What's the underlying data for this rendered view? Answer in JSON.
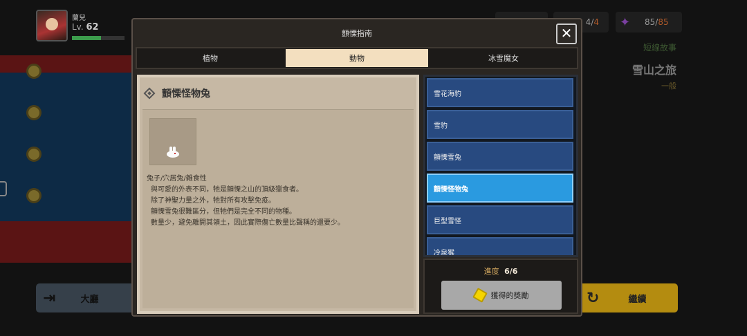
{
  "player": {
    "name": "蘭兒",
    "level_prefix": "Lv.",
    "level": "62",
    "xp_fraction": 0.55
  },
  "resources": {
    "energy_current": "4",
    "energy_max": "4",
    "gem_current": "85",
    "gem_max": "85"
  },
  "story": {
    "type": "短線故事",
    "title": "雪山之旅",
    "difficulty": "一般"
  },
  "buttons": {
    "lobby_label": "大廳",
    "continue_label": "繼續"
  },
  "modal": {
    "title": "顫慄指南",
    "close_symbol": "✕",
    "tabs": [
      {
        "label": "植物",
        "active": false
      },
      {
        "label": "動物",
        "active": true
      },
      {
        "label": "冰雪魔女",
        "active": false
      }
    ],
    "detail": {
      "name": "顫慄怪物兔",
      "description": [
        "兔子/穴居兔/雜食性",
        "與可愛的外表不同，牠是顫慄之山的頂級獵食者。",
        "除了神聖力量之外，牠對所有攻擊免疫。",
        "顫慄雪兔很難區分，但牠們是完全不同的物種。",
        "數量少，避免離開其領土，因此實際傷亡數量比聲稱的還要少。"
      ]
    },
    "list": [
      {
        "label": "雪花海豹",
        "active": false
      },
      {
        "label": "雪豹",
        "active": false
      },
      {
        "label": "顫慄雪兔",
        "active": false
      },
      {
        "label": "顫慄怪物兔",
        "active": true
      },
      {
        "label": "巨型雪怪",
        "active": false
      },
      {
        "label": "冷泉猴",
        "active": false
      }
    ],
    "progress_label": "進度",
    "progress_value": "6/6",
    "reward_label": "獲得的獎勵"
  },
  "colors": {
    "active_tab": "#f3dfbf",
    "list_item": "#284a80",
    "list_item_active": "#2a9ae0",
    "progress_label": "#d6aa60"
  }
}
